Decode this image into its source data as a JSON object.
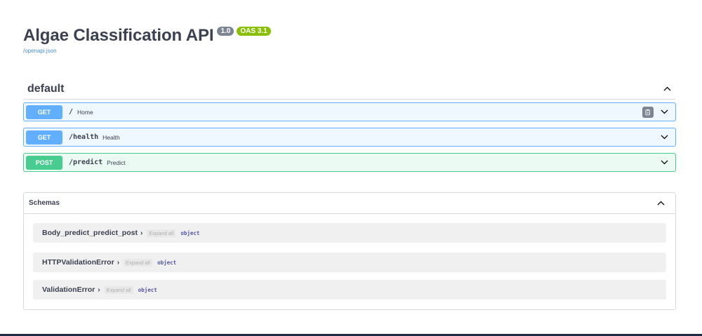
{
  "info": {
    "title": "Algae Classification API",
    "version": "1.0",
    "oas": "OAS 3.1",
    "spec_link": "/openapi.json"
  },
  "tag": {
    "name": "default"
  },
  "operations": [
    {
      "method": "GET",
      "path": "/",
      "summary": "Home"
    },
    {
      "method": "GET",
      "path": "/health",
      "summary": "Health"
    },
    {
      "method": "POST",
      "path": "/predict",
      "summary": "Predict"
    }
  ],
  "schemas": {
    "title": "Schemas",
    "items": [
      {
        "name": "Body_predict_predict_post",
        "arrow": "›",
        "expand": "Expand all",
        "type": "object"
      },
      {
        "name": "HTTPValidationError",
        "arrow": "›",
        "expand": "Expand all",
        "type": "object"
      },
      {
        "name": "ValidationError",
        "arrow": "›",
        "expand": "Expand all",
        "type": "object"
      }
    ]
  },
  "colors": {
    "get": "#61affe",
    "post": "#49cc90",
    "version_badge": "#7d8492",
    "oas_badge": "#89bf04",
    "link": "#4990e2"
  }
}
